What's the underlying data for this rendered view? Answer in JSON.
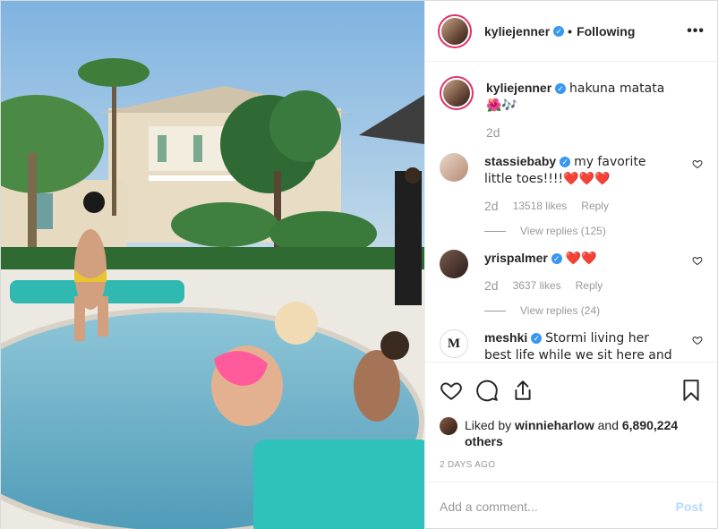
{
  "header": {
    "username": "kyliejenner",
    "separator": "•",
    "follow_status": "Following",
    "more_label": "•••"
  },
  "caption": {
    "username": "kyliejenner",
    "text": "hakuna matata 🌺🎶",
    "age": "2d"
  },
  "comments": [
    {
      "username": "stassiebaby",
      "text": "my favorite little toes!!!!❤️❤️❤️",
      "age": "2d",
      "likes": "13518 likes",
      "reply_label": "Reply",
      "view_replies": "View replies (125)"
    },
    {
      "username": "yrispalmer",
      "text": "❤️❤️",
      "age": "2d",
      "likes": "3637 likes",
      "reply_label": "Reply",
      "view_replies": "View replies (24)"
    },
    {
      "username": "meshki",
      "text": "Stormi living her best life while we sit here and watch 😍😭 😍",
      "avatar_letters": "M"
    }
  ],
  "liked_by": {
    "prefix": "Liked by",
    "user": "winnieharlow",
    "connector": "and",
    "others": "6,890,224 others"
  },
  "date": "2 DAYS AGO",
  "add_comment": {
    "placeholder": "Add a comment...",
    "post_label": "Post"
  },
  "colors": {
    "verified": "#3897f0",
    "story_ring": "#e1306c",
    "post_disabled": "#b3dbff",
    "secondary_text": "#999999"
  },
  "icons": [
    "heart-icon",
    "comment-icon",
    "share-icon",
    "bookmark-icon",
    "more-icon",
    "verified-icon"
  ]
}
